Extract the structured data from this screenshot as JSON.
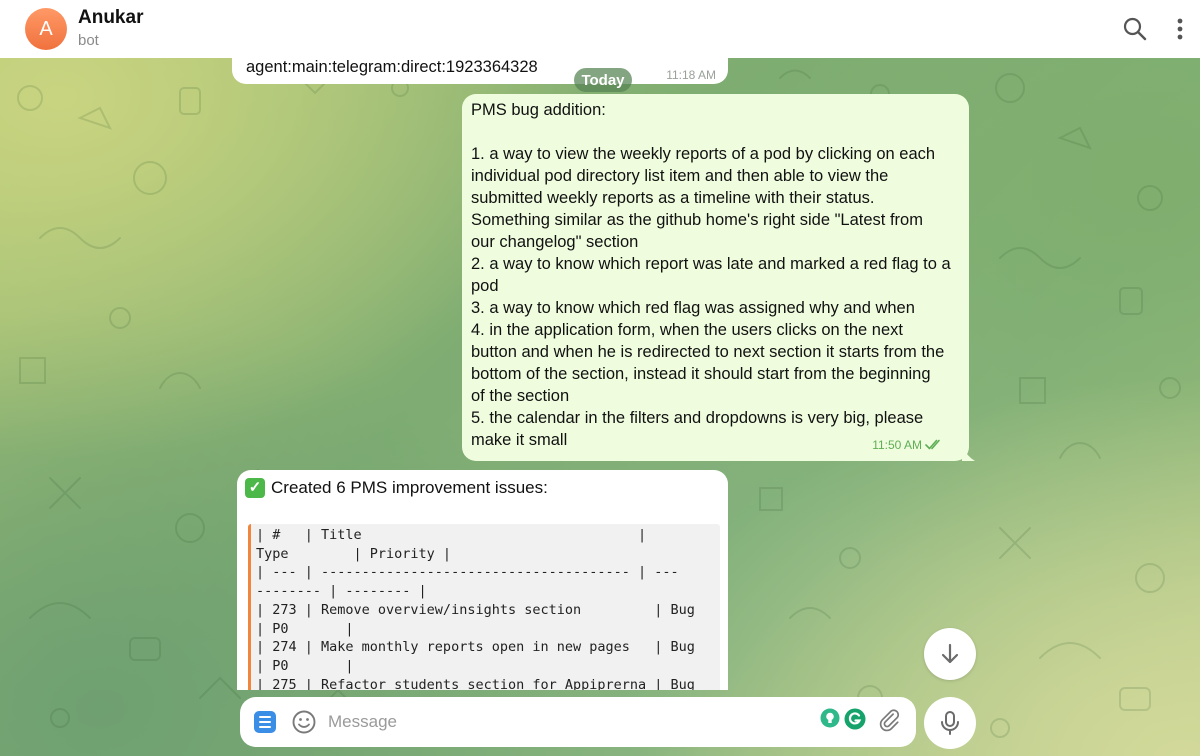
{
  "header": {
    "avatar_letter": "A",
    "chat_name": "Anukar",
    "chat_status": "bot"
  },
  "messages": {
    "top": {
      "text": "agent:main:telegram:direct:1923364328",
      "time": "11:18 AM"
    },
    "date_separator": "Today",
    "outgoing": {
      "lines": [
        "PMS bug addition:",
        "",
        "1. a way to view the weekly reports of a pod by clicking on each",
        "individual pod directory list item and then able to view the",
        "submitted weekly reports as a timeline with their status.",
        "Something similar as the github home's right side \"Latest from",
        "our changelog\" section",
        "2. a way to know which report was late and marked a red flag to a",
        "pod",
        "3. a way to know which red flag was assigned why and when",
        "4. in the application form, when the users clicks on the next",
        "button and when he is redirected to next section it starts from the",
        "bottom of the section, instead it should start from the beginning",
        "of the section",
        "5. the calendar in the filters and dropdowns is very big, please",
        "make it small"
      ],
      "time": "11:50 AM",
      "status": "read"
    },
    "incoming": {
      "heading": "Created 6 PMS improvement issues:",
      "code_lines": [
        "| #   | Title                                  |",
        "Type        | Priority |",
        "| --- | -------------------------------------- | ---",
        "-------- | -------- |",
        "| 273 | Remove overview/insights section         | Bug",
        "| P0       |",
        "| 274 | Make monthly reports open in new pages   | Bug",
        "| P0       |",
        "| 275 | Refactor students section for Appiprerna | Bug"
      ]
    }
  },
  "composer": {
    "placeholder": "Message"
  },
  "colors": {
    "accent": "#3a8ee6",
    "outgoing_bubble": "#effdde",
    "read_check": "#5fae55",
    "code_border": "#f0863d"
  },
  "icons": [
    "search-icon",
    "more-vertical-icon",
    "menu-icon",
    "emoji-icon",
    "attach-icon",
    "mic-icon",
    "arrow-down-icon",
    "double-check-icon"
  ]
}
